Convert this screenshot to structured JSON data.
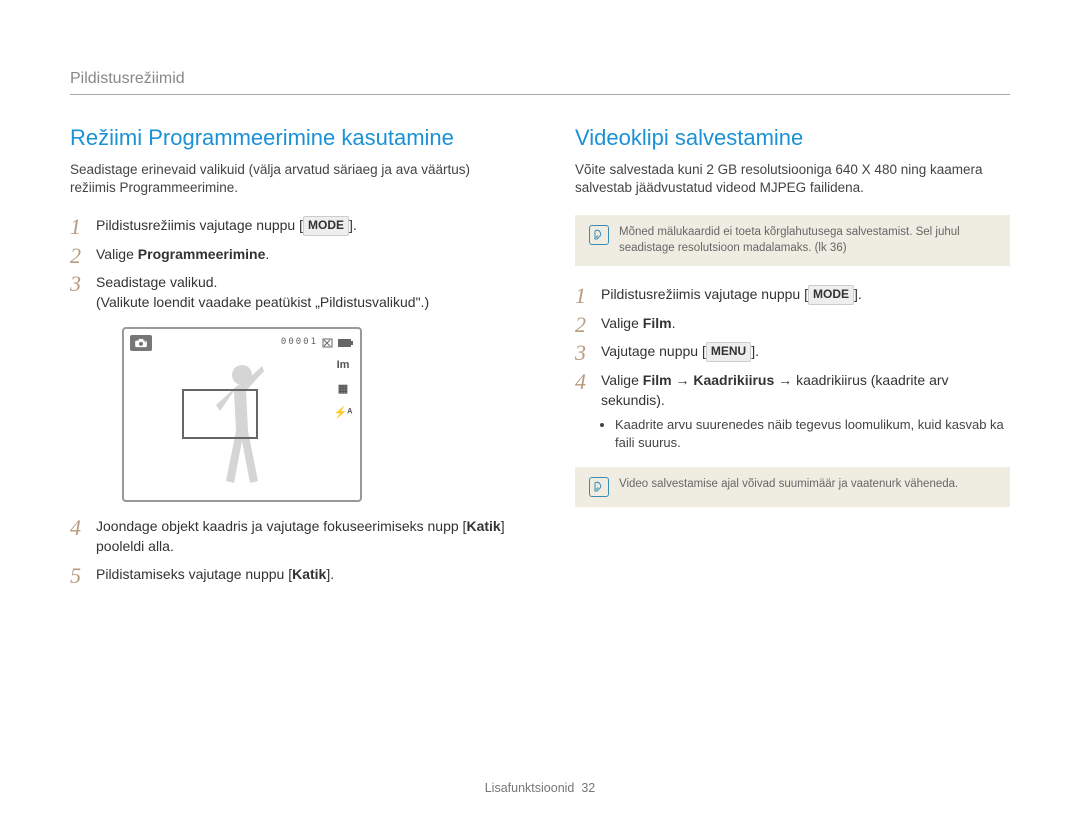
{
  "header": {
    "breadcrumb": "Pildistusrežiimid"
  },
  "left": {
    "title": "Režiimi Programmeerimine kasutamine",
    "intro": "Seadistage erinevaid valikuid (välja arvatud säriaeg ja ava väärtus) režiimis Programmeerimine.",
    "steps": {
      "s1_pre": "Pildistusrežiimis vajutage nuppu [",
      "s1_btn": "MODE",
      "s1_post": "].",
      "s2_pre": "Valige ",
      "s2_bold": "Programmeerimine",
      "s2_post": ".",
      "s3_line1": "Seadistage valikud.",
      "s3_line2": "(Valikute loendit vaadake peatükist „Pildistusvalikud\".)",
      "s4_pre": "Joondage objekt kaadris ja vajutage fokuseerimiseks nupp [",
      "s4_bold": "Katik",
      "s4_post": "] pooleldi alla.",
      "s5_pre": "Pildistamiseks vajutage nuppu [",
      "s5_bold": "Katik",
      "s5_post": "]."
    },
    "lcd": {
      "counter": "00001",
      "side": {
        "i1": "Im",
        "i2": "▦",
        "i3": "⚡ᴬ"
      }
    }
  },
  "right": {
    "title": "Videoklipi salvestamine",
    "intro": "Võite salvestada kuni 2 GB resolutsiooniga 640 X 480 ning kaamera salvestab jäädvustatud videod MJPEG failidena.",
    "note1": "Mõned mälukaardid ei toeta kõrglahutusega salvestamist. Sel juhul seadistage resolutsioon madalamaks. (lk 36)",
    "steps": {
      "s1_pre": "Pildistusrežiimis vajutage nuppu [",
      "s1_btn": "MODE",
      "s1_post": "].",
      "s2_pre": "Valige ",
      "s2_bold": "Film",
      "s2_post": ".",
      "s3_pre": "Vajutage nuppu [",
      "s3_btn": "MENU",
      "s3_post": "].",
      "s4_pre": "Valige ",
      "s4_b1": "Film",
      "s4_arrow1": " → ",
      "s4_b2": "Kaadrikiirus",
      "s4_arrow2": " → ",
      "s4_tail": "kaadrikiirus (kaadrite arv sekundis).",
      "s4_sub": "Kaadrite arvu suurenedes näib tegevus loomulikum, kuid kasvab ka faili suurus."
    },
    "note2": "Video salvestamise ajal võivad suumimäär ja vaatenurk väheneda."
  },
  "footer": {
    "label": "Lisafunktsioonid",
    "page": "32"
  }
}
